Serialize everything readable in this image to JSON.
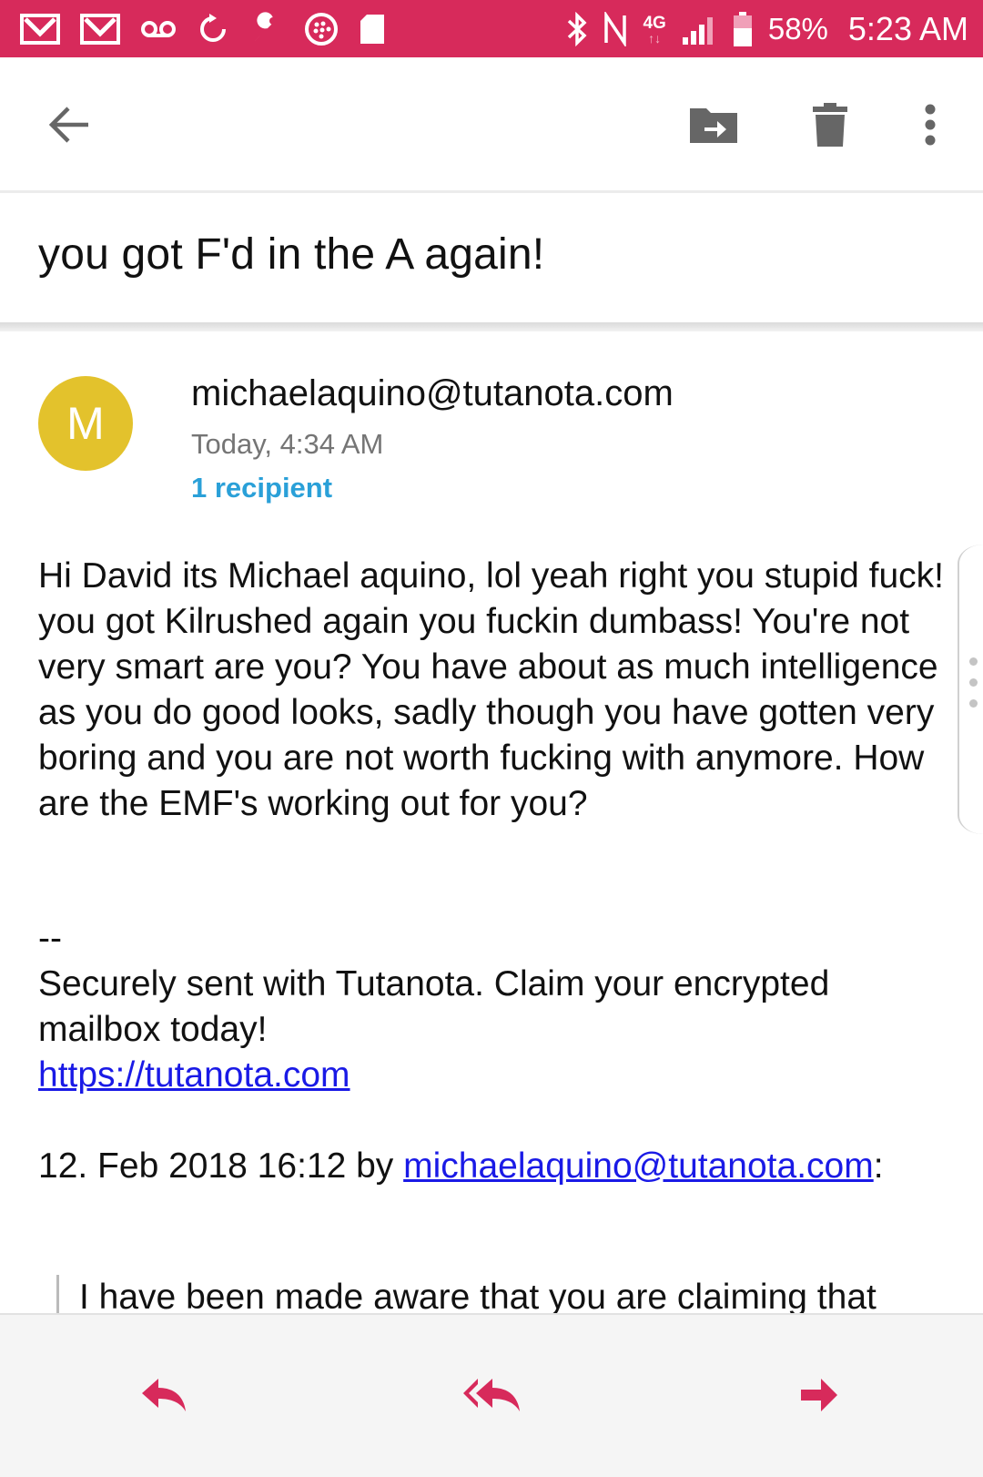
{
  "status_bar": {
    "battery": "58%",
    "time": "5:23 AM",
    "network": "4G",
    "accent": "#d72a5b",
    "icons_left": [
      "gmail-icon",
      "gmail-icon",
      "voicemail-icon",
      "sync-icon",
      "wrench-icon",
      "blackberry-icon",
      "sd-card-icon"
    ],
    "icons_right": [
      "bluetooth-icon",
      "nfc-icon",
      "lte-icon",
      "signal-icon",
      "battery-icon"
    ]
  },
  "toolbar": {
    "back": "arrow-back-icon",
    "move": "move-to-folder-icon",
    "delete": "trash-icon",
    "more": "more-vert-icon"
  },
  "email": {
    "subject": "you got F'd in the A again!",
    "avatar_letter": "M",
    "avatar_color": "#e3c22c",
    "sender": "michaelaquino@tutanota.com",
    "time": "Today, 4:34 AM",
    "recipients": "1 recipient",
    "body": "Hi David its Michael aquino, lol yeah right you stupid fuck! you got Kilrushed again you fuckin dumbass! You're not very smart are you? You have about as much intelligence as you do good looks, sadly though you have gotten very boring and you are not worth fucking with anymore. How are the EMF's working out for you?",
    "sig_separator": "--",
    "signature": "Securely sent with Tutanota. Claim your encrypted mailbox today!",
    "signature_link": "https://tutanota.com",
    "quote_header_prefix": "12. Feb 2018 16:12 by ",
    "quote_header_link": "michaelaquino@tutanota.com",
    "quote_header_suffix": ":",
    "quoted_text": "I have been made aware that you are claiming that"
  },
  "bottom_bar": {
    "reply": "reply-icon",
    "reply_all": "reply-all-icon",
    "forward": "forward-icon",
    "accent": "#d72a5b"
  }
}
